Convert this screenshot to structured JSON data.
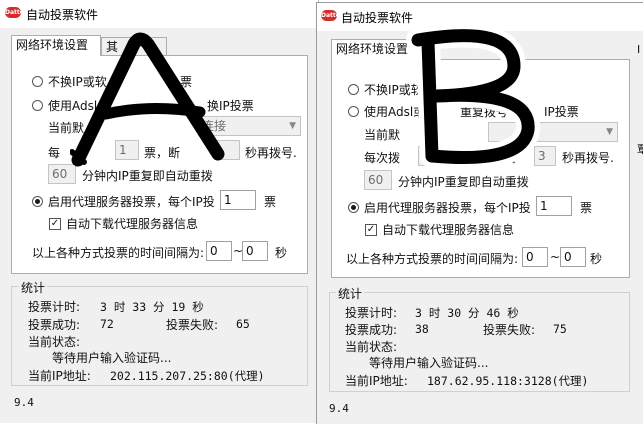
{
  "app": {
    "title": "自动投票软件",
    "icon_text": "Datto"
  },
  "tabs": [
    "网络环境设置",
    "其"
  ],
  "windowA": {
    "options": {
      "no_switch": "不换IP或软",
      "no_switch_tail": "票",
      "adsl": "使用Adsl",
      "adsl_tail": "换IP投票",
      "current_default": "当前默",
      "combo_value": "连接",
      "every": "每",
      "count_value": "1",
      "ticket_break": "票，断",
      "redial": "秒再拨号.",
      "minutes_value": "60",
      "minutes_text": "分钟内IP重复即自动重拨",
      "proxy": "启用代理服务器投票，每个IP投",
      "proxy_value": "1",
      "proxy_unit": "票",
      "auto_download": "自动下载代理服务器信息",
      "interval": "以上各种方式投票的时间间隔为:",
      "interval_from": "0",
      "interval_sep": "~",
      "interval_to": "0",
      "interval_unit": "秒"
    },
    "stats": {
      "header": "统计",
      "timer_label": "投票计时:",
      "timer_value": "3 时 33 分 19 秒",
      "success_label": "投票成功:",
      "success_value": "72",
      "fail_label": "投票失败:",
      "fail_value": "65",
      "status_label": "当前状态:",
      "status_value": "等待用户输入验证码...",
      "ip_label": "当前IP地址:",
      "ip_value": "202.115.207.25:80(代理)"
    },
    "version": "9.4"
  },
  "windowB": {
    "options": {
      "no_switch": "不换IP或软",
      "adsl": "使用Adsl或",
      "adsl_mid": "重复拨号",
      "adsl_tail": "IP投票",
      "current_default": "当前默",
      "combo_value": "",
      "every": "每次拨",
      "count_value": "1",
      "ticket_break": "票",
      "break_tail": "断开后",
      "seconds_value": "3",
      "redial": "秒再拨号.",
      "minutes_value": "60",
      "minutes_text": "分钟内IP重复即自动重拨",
      "proxy": "启用代理服务器投票，每个IP投",
      "proxy_value": "1",
      "proxy_unit": "票",
      "auto_download": "自动下载代理服务器信息",
      "interval": "以上各种方式投票的时间间隔为:",
      "interval_from": "0",
      "interval_sep": "~",
      "interval_to": "0",
      "interval_unit": "秒"
    },
    "stats": {
      "header": "统计",
      "timer_label": "投票计时:",
      "timer_value": "3 时 30 分 46 秒",
      "success_label": "投票成功:",
      "success_value": "38",
      "fail_label": "投票失败:",
      "fail_value": "75",
      "status_label": "当前状态:",
      "status_value": "等待用户输入验证码...",
      "ip_label": "当前IP地址:",
      "ip_value": "187.62.95.118:3128(代理)"
    },
    "version": "9.4",
    "edge_text": [
      "I",
      "覃"
    ]
  },
  "overlay": {
    "letter_a": "A",
    "letter_b": "B"
  }
}
